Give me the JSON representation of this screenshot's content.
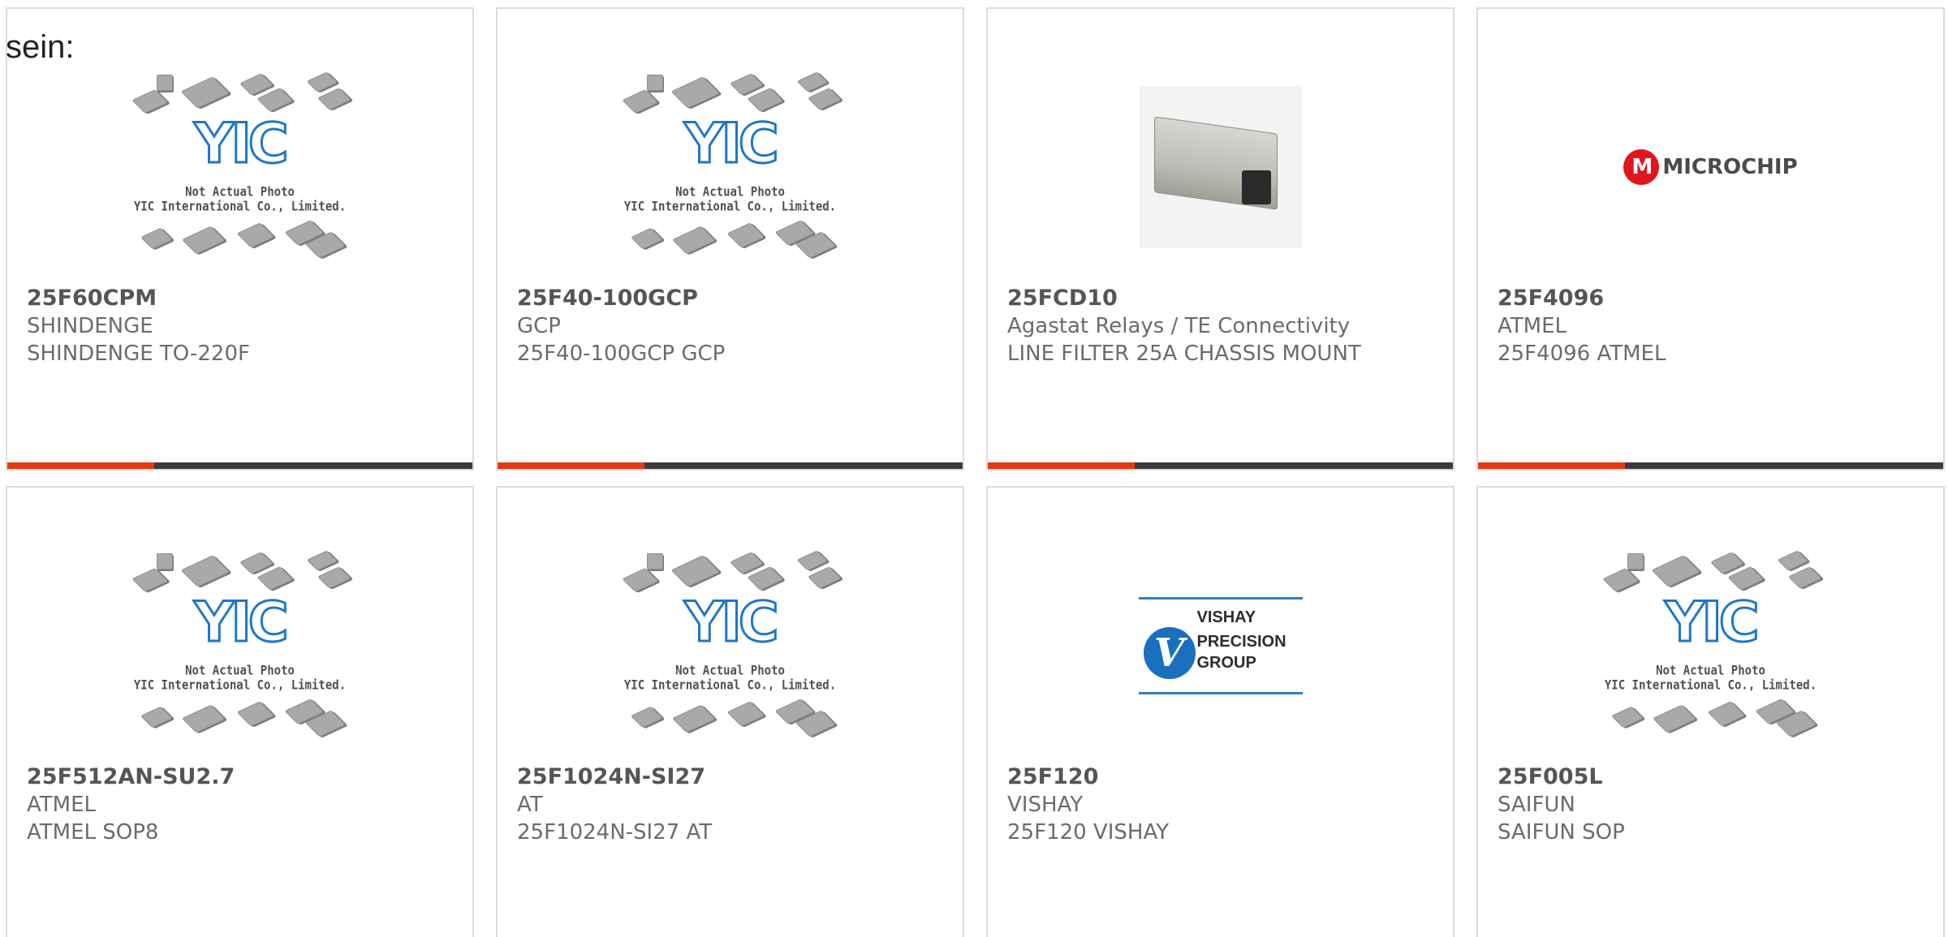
{
  "intro_text": "sein:",
  "accent_color": "#e8380d",
  "bar_color": "#3b3b3b",
  "placeholder": {
    "logo": "YIC",
    "caption_line1": "Not Actual Photo",
    "caption_line2": "YIC International Co., Limited."
  },
  "brand_logos": {
    "microchip": "MICROCHIP",
    "vishay_line1": "VISHAY",
    "vishay_line2": "PRECISION",
    "vishay_line3": "GROUP"
  },
  "products": [
    {
      "part": "25F60CPM",
      "brand": "SHINDENGE",
      "desc": "SHINDENGE TO-220F",
      "image": "placeholder-chips"
    },
    {
      "part": "25F40-100GCP",
      "brand": "GCP",
      "desc": "25F40-100GCP GCP",
      "image": "placeholder-chips"
    },
    {
      "part": "25FCD10",
      "brand": "Agastat Relays / TE Connectivity",
      "desc": "LINE FILTER 25A CHASSIS MOUNT",
      "image": "line-filter-photo"
    },
    {
      "part": "25F4096",
      "brand": "ATMEL",
      "desc": "25F4096 ATMEL",
      "image": "microchip-logo"
    },
    {
      "part": "25F512AN-SU2.7",
      "brand": "ATMEL",
      "desc": "ATMEL SOP8",
      "image": "placeholder-chips"
    },
    {
      "part": "25F1024N-SI27",
      "brand": "AT",
      "desc": "25F1024N-SI27 AT",
      "image": "placeholder-chips"
    },
    {
      "part": "25F120",
      "brand": "VISHAY",
      "desc": "25F120 VISHAY",
      "image": "vishay-logo"
    },
    {
      "part": "25F005L",
      "brand": "SAIFUN",
      "desc": "SAIFUN SOP",
      "image": "placeholder-chips"
    }
  ]
}
